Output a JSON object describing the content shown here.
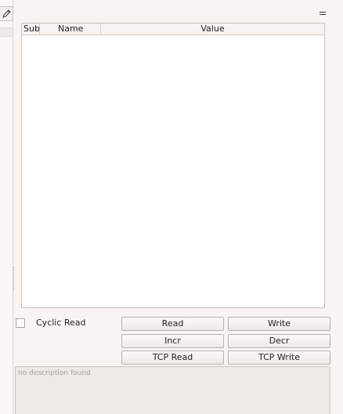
{
  "toolbar": {
    "edit_icon": "pencil-icon",
    "menu_icon": "hamburger-icon"
  },
  "table": {
    "columns": [
      "Sub",
      "Name",
      "Value"
    ],
    "rows": []
  },
  "cyclic_read": {
    "label": "Cyclic Read",
    "checked": false
  },
  "buttons": {
    "read": "Read",
    "write": "Write",
    "incr": "Incr",
    "decr": "Decr",
    "tcp_read": "TCP Read",
    "tcp_write": "TCP Write"
  },
  "description": {
    "text": "no description found"
  }
}
